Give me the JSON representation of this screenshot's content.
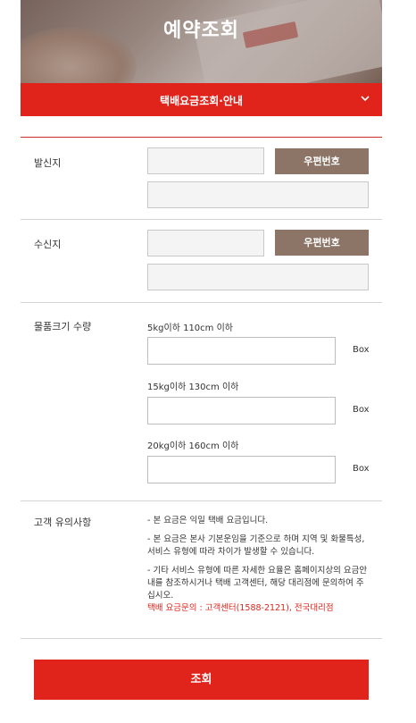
{
  "header": {
    "title": "예약조회"
  },
  "dropdown": {
    "label": "택배요금조회·안내",
    "icon": "chevron-down-icon"
  },
  "sender": {
    "label": "발신지",
    "zip_button": "우편번호",
    "zip_value": "",
    "address_value": ""
  },
  "receiver": {
    "label": "수신지",
    "zip_button": "우편번호",
    "zip_value": "",
    "address_value": ""
  },
  "quantity": {
    "label": "물품크기 수량",
    "items": [
      {
        "size": "5kg이하 110cm 이하",
        "unit": "Box",
        "value": ""
      },
      {
        "size": "15kg이하 130cm 이하",
        "unit": "Box",
        "value": ""
      },
      {
        "size": "20kg이하 160cm 이하",
        "unit": "Box",
        "value": ""
      }
    ]
  },
  "notice": {
    "label": "고객 유의사항",
    "lines": [
      "- 본 요금은 익일 택배 요금입니다.",
      "- 본 요금은 본사 기본운임을 기준으로 하며 지역 및 화물특성, 서비스 유형에 따라 차이가 발생할 수 있습니다.",
      "- 기타 서비스 유형에 따른 자세한 요율은 홈페이지상의 요금안내를 참조하시거나 택배 고객센터, 해당 대리점에 문의하여 주십시오."
    ],
    "contact": "택배 요금문의 : 고객센터(1588-2121), 전국대리점"
  },
  "submit": {
    "label": "조회"
  },
  "colors": {
    "accent": "#e0241b",
    "zip_button": "#8c7467"
  }
}
